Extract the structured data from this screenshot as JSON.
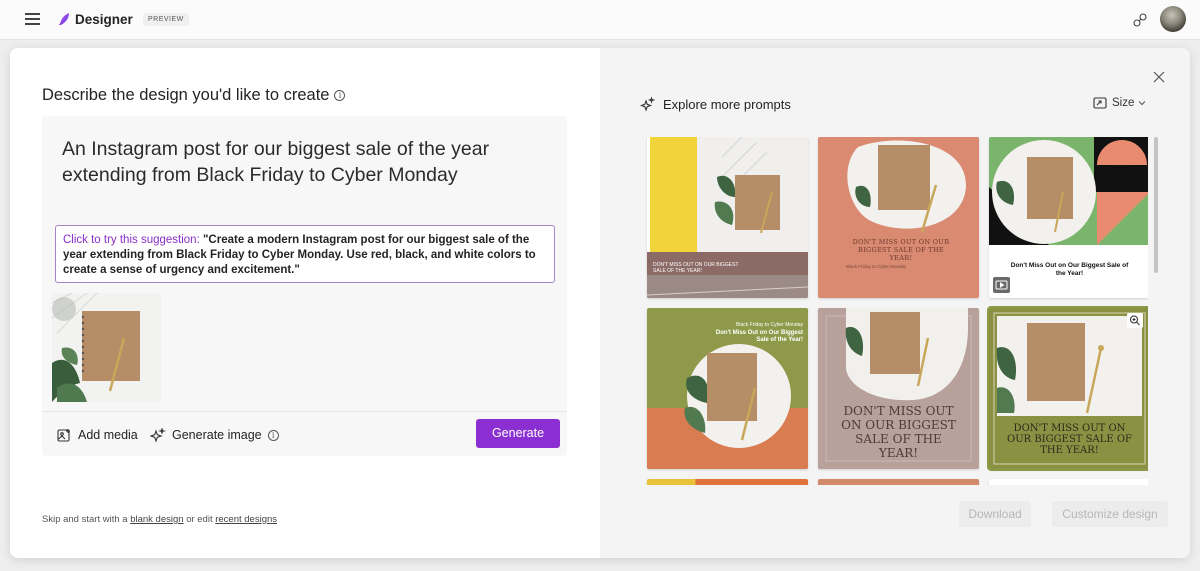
{
  "header": {
    "brand": "Designer",
    "badge": "PREVIEW"
  },
  "left": {
    "title": "Describe the design you'd like to create",
    "info_glyph": "i",
    "prompt_text": "An Instagram post for our biggest sale of the year extending from Black Friday to Cyber Monday",
    "suggestion_lead": "Click to try this suggestion:",
    "suggestion_body": "\"Create a modern Instagram post for our biggest sale of the year extending from Black Friday to Cyber Monday. Use red, black, and white colors to create a sense of urgency and excitement.\"",
    "add_media": "Add media",
    "generate_image": "Generate image",
    "generate_button": "Generate",
    "footer_prefix": "Skip and start with a",
    "footer_blank": "blank design",
    "footer_mid": "or edit",
    "footer_recent": "recent designs"
  },
  "right": {
    "explore": "Explore more prompts",
    "size": "Size",
    "download": "Download",
    "customize": "Customize design"
  },
  "cards": [
    {
      "caption": "DON'T MISS OUT ON OUR BIGGEST SALE OF THE YEAR!"
    },
    {
      "caption": "DON'T MISS OUT ON OUR BIGGEST SALE OF THE YEAR!",
      "sub": "Black Friday to Cyber Monday"
    },
    {
      "caption": "Don't Miss Out on Our Biggest Sale of the Year!"
    },
    {
      "top": "Black Friday to Cyber Monday",
      "caption": "Don't Miss Out on Our Biggest Sale of the Year!"
    },
    {
      "caption": "DON'T MISS OUT ON OUR BIGGEST SALE OF THE YEAR!"
    },
    {
      "caption": "DON'T MISS OUT ON OUR BIGGEST SALE OF THE YEAR!"
    }
  ],
  "colors": {
    "accent": "#8b2fd2",
    "suggestion_lead": "#8a2fc7",
    "suggestion_border": "#a883c6"
  }
}
